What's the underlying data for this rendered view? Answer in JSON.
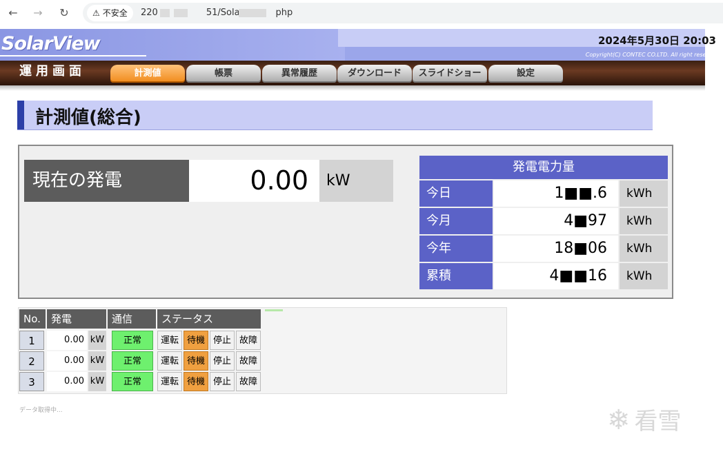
{
  "browser": {
    "security_label": "不安全",
    "url_parts": [
      "220",
      "51/Sola",
      "php"
    ]
  },
  "header": {
    "logo": "SolarView",
    "datetime": "2024年5月30日 20:03",
    "copyright": "Copyright(C) CONTEC CO.LTD. All right reserved."
  },
  "menu": {
    "mode_label": "運用画面",
    "tabs": [
      {
        "label": "計測値",
        "active": true
      },
      {
        "label": "帳票",
        "active": false
      },
      {
        "label": "異常履歴",
        "active": false
      },
      {
        "label": "ダウンロード",
        "active": false
      },
      {
        "label": "スライドショー",
        "active": false
      },
      {
        "label": "設定",
        "active": false
      }
    ]
  },
  "page": {
    "title": "計測値(総合)"
  },
  "current": {
    "label": "現在の発電",
    "value": "0.00",
    "unit": "kW"
  },
  "energy": {
    "title": "発電電力量",
    "rows": [
      {
        "label": "今日",
        "value": "1■■.6",
        "unit": "kWh"
      },
      {
        "label": "今月",
        "value": "4■97",
        "unit": "kWh"
      },
      {
        "label": "今年",
        "value": "18■06",
        "unit": "kWh"
      },
      {
        "label": "累積",
        "value": "4■■16",
        "unit": "kWh"
      }
    ]
  },
  "units_table": {
    "headers": {
      "no": "No.",
      "gen": "発電",
      "comm": "通信",
      "status": "ステータス"
    },
    "status_labels": [
      "運転",
      "待機",
      "停止",
      "故障"
    ],
    "rows": [
      {
        "no": "1",
        "gen": "0.00",
        "unit": "kW",
        "comm": "正常",
        "active_status": "待機"
      },
      {
        "no": "2",
        "gen": "0.00",
        "unit": "kW",
        "comm": "正常",
        "active_status": "待機"
      },
      {
        "no": "3",
        "gen": "0.00",
        "unit": "kW",
        "comm": "正常",
        "active_status": "待機"
      }
    ]
  },
  "footer": {
    "status": "データ取得中..."
  },
  "watermark": {
    "text": "看雪"
  },
  "colors": {
    "accent": "#5b62c7",
    "active_tab": "#f08a1a",
    "comm_ok": "#6ef06e",
    "status_on": "#f0a040"
  }
}
